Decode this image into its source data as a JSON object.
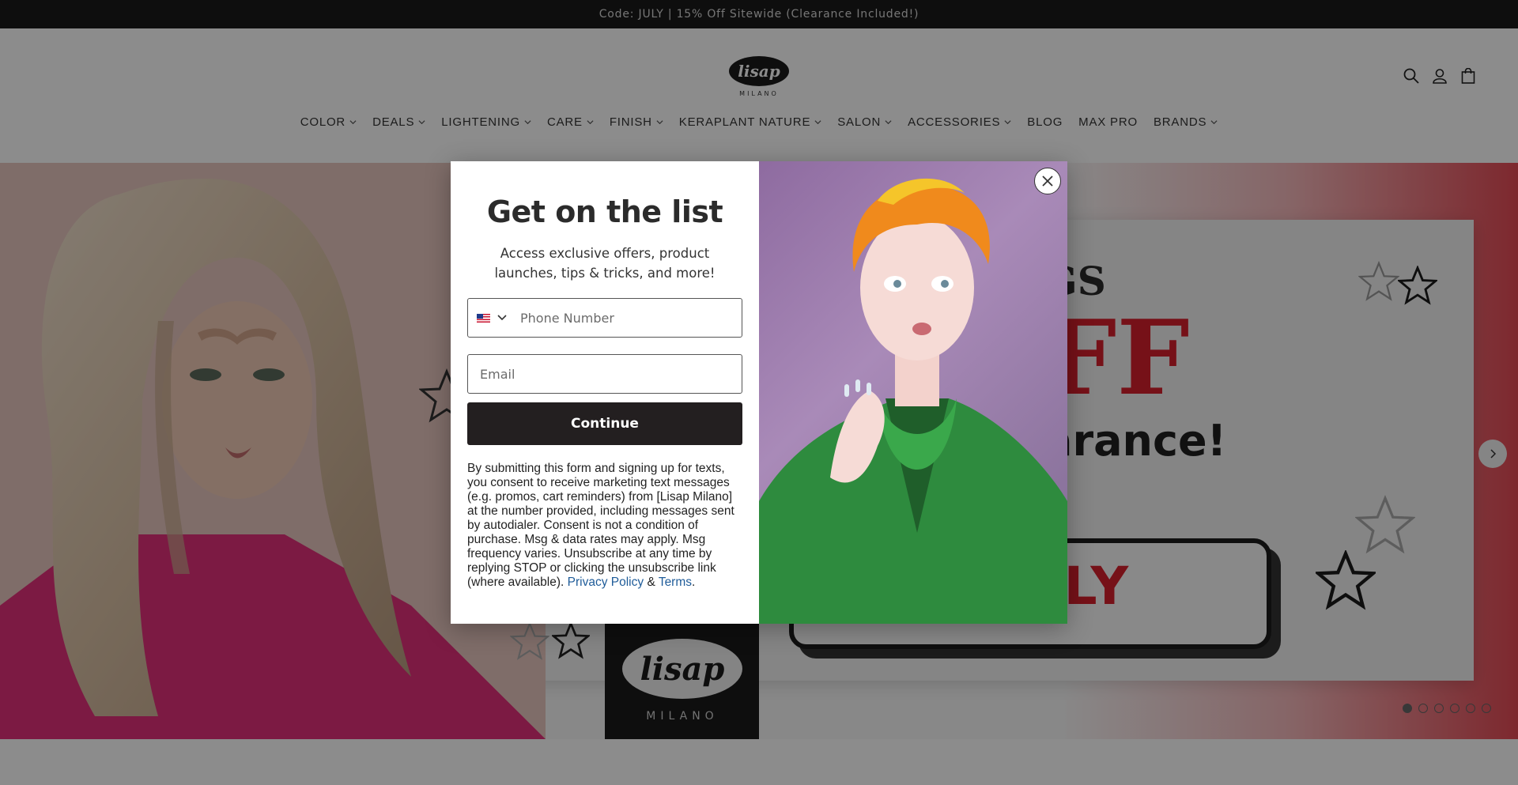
{
  "announcement": {
    "text": "Code: JULY | 15% Off Sitewide (Clearance Included!)"
  },
  "header": {
    "logo_text": "lisap",
    "logo_subtext": "MILANO",
    "icons": [
      "search-icon",
      "account-icon",
      "cart-icon"
    ]
  },
  "nav": {
    "items": [
      {
        "label": "COLOR",
        "has_dropdown": true
      },
      {
        "label": "DEALS ",
        "has_dropdown": true
      },
      {
        "label": "LIGHTENING",
        "has_dropdown": true
      },
      {
        "label": "CARE",
        "has_dropdown": true
      },
      {
        "label": "FINISH",
        "has_dropdown": true
      },
      {
        "label": "KERAPLANT NATURE",
        "has_dropdown": true
      },
      {
        "label": "SALON",
        "has_dropdown": true
      },
      {
        "label": "ACCESSORIES",
        "has_dropdown": true
      },
      {
        "label": "BLOG",
        "has_dropdown": false
      },
      {
        "label": "MAX PRO",
        "has_dropdown": false
      },
      {
        "label": "BRANDS",
        "has_dropdown": true
      }
    ]
  },
  "hero": {
    "line1": "GS",
    "line2": "FF",
    "line3": "arance!",
    "code": "ULY",
    "logo_text": "lisap",
    "logo_subtext": "MILANO",
    "slide_count": 6,
    "active_slide": 0
  },
  "modal": {
    "title": "Get on the list",
    "subtitle": "Access exclusive offers, product launches, tips & tricks, and more!",
    "phone_placeholder": "Phone Number",
    "email_placeholder": "Email",
    "continue_label": "Continue",
    "disclaimer": "By submitting this form and signing up for texts, you consent to receive marketing text messages (e.g. promos, cart reminders) from [Lisap Milano] at the number provided, including messages sent by autodialer. Consent is not a condition of purchase. Msg & data rates may apply. Msg frequency varies. Unsubscribe at any time by replying STOP or clicking the unsubscribe link (where available).",
    "privacy_label": "Privacy Policy",
    "and_text": "&",
    "terms_label": "Terms",
    "period": "."
  },
  "colors": {
    "announcement_bg": "#1a1a1a",
    "accent_red": "#d8202d",
    "button_dark": "#231f20",
    "link_blue": "#1f5c99",
    "jacket_green": "#2e8b3e",
    "hair_orange": "#f08a1c"
  }
}
